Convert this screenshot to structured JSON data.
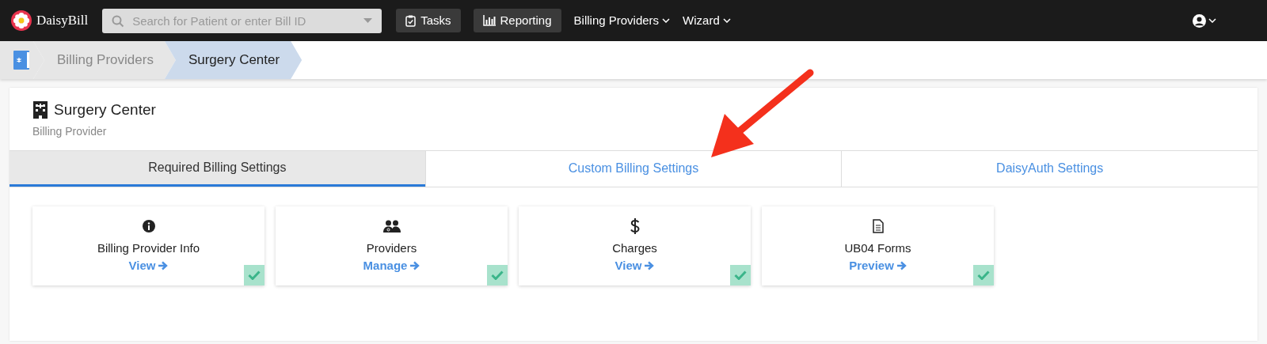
{
  "navbar": {
    "brand": "DaisyBill",
    "search": {
      "placeholder": "Search for Patient or enter Bill ID"
    },
    "items": [
      {
        "label": "Tasks",
        "kind": "button",
        "selected": false
      },
      {
        "label": "Reporting",
        "kind": "button",
        "selected": false
      },
      {
        "label": "Billing Providers",
        "kind": "menu",
        "selected": false
      },
      {
        "label": "Wizard",
        "kind": "menu",
        "selected": false
      }
    ]
  },
  "breadcrumb": [
    {
      "label": "Billing Providers",
      "selected": false
    },
    {
      "label": "Surgery Center",
      "selected": true
    }
  ],
  "page": {
    "title": "Surgery Center",
    "subtitle": "Billing Provider"
  },
  "tabs": [
    {
      "label": "Required Billing Settings",
      "selected": true
    },
    {
      "label": "Custom Billing Settings",
      "selected": false
    },
    {
      "label": "DaisyAuth Settings",
      "selected": false
    }
  ],
  "cards": [
    {
      "kind": "info",
      "title": "Billing Provider Info",
      "link": "View",
      "checked": true
    },
    {
      "kind": "people",
      "title": "Providers",
      "link": "Manage",
      "checked": true
    },
    {
      "kind": "dollar",
      "title": "Charges",
      "link": "View",
      "checked": true
    },
    {
      "kind": "document",
      "title": "UB04 Forms",
      "link": "Preview",
      "checked": true
    }
  ]
}
